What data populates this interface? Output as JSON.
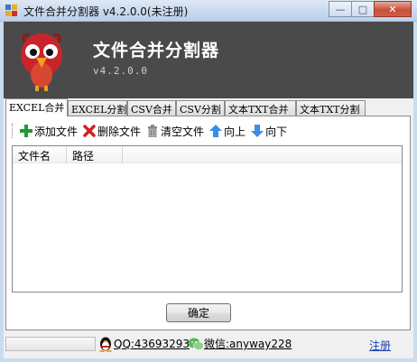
{
  "window": {
    "title": "文件合并分割器 v4.2.0.0(未注册)",
    "minimize_label": "—",
    "maximize_label": "□",
    "close_label": "✕"
  },
  "banner": {
    "title": "文件合并分割器",
    "version": "v4.2.0.0"
  },
  "tabs": [
    {
      "label": "EXCEL合并",
      "active": true
    },
    {
      "label": "EXCEL分割",
      "active": false
    },
    {
      "label": "CSV合并",
      "active": false
    },
    {
      "label": "CSV分割",
      "active": false
    },
    {
      "label": "文本TXT合并",
      "active": false
    },
    {
      "label": "文本TXT分割",
      "active": false
    }
  ],
  "toolbar": {
    "add_label": "添加文件",
    "delete_label": "删除文件",
    "clear_label": "清空文件",
    "up_label": "向上",
    "down_label": "向下"
  },
  "list": {
    "columns": [
      "文件名",
      "路径"
    ],
    "rows": []
  },
  "confirm_label": "确定",
  "status": {
    "progress": 0,
    "qq": "QQ:43693293",
    "wechat": "微信:anyway228",
    "register": "注册"
  },
  "colors": {
    "banner_bg": "#4a4a4a",
    "add_icon": "#1e9a2e",
    "delete_icon": "#d42020",
    "arrow_icon": "#3a8ee6"
  }
}
